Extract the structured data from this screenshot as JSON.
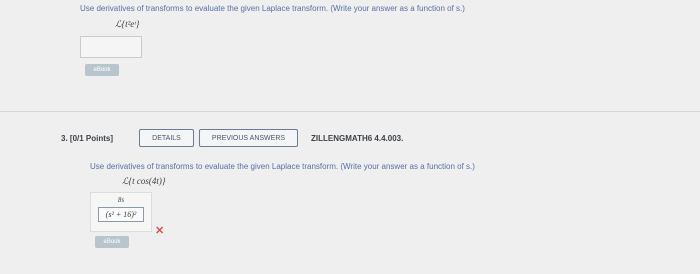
{
  "previous_question": {
    "instruction": "Use derivatives of transforms to evaluate the given Laplace transform. (Write your answer as a function of s.)",
    "formula": "ℒ{t²eᵗ}",
    "answer_value": "",
    "ebook_label": "eBook"
  },
  "question": {
    "number": "3.",
    "points": "[0/1 Points]",
    "details_label": "DETAILS",
    "previous_answers_label": "PREVIOUS ANSWERS",
    "source": "ZILLENGMATH6 4.4.003.",
    "instruction": "Use derivatives of transforms to evaluate the given Laplace transform. (Write your answer as a function of s.)",
    "formula": "ℒ{t cos(4t)}",
    "answer": {
      "numerator": "8s",
      "denominator": "(s² + 16)²"
    },
    "status_icon": "x-mark-icon",
    "ebook_label": "eBook"
  },
  "colors": {
    "link_text": "#5a6fa6",
    "wrong": "#d9534f",
    "button_border": "#6d7c93"
  }
}
